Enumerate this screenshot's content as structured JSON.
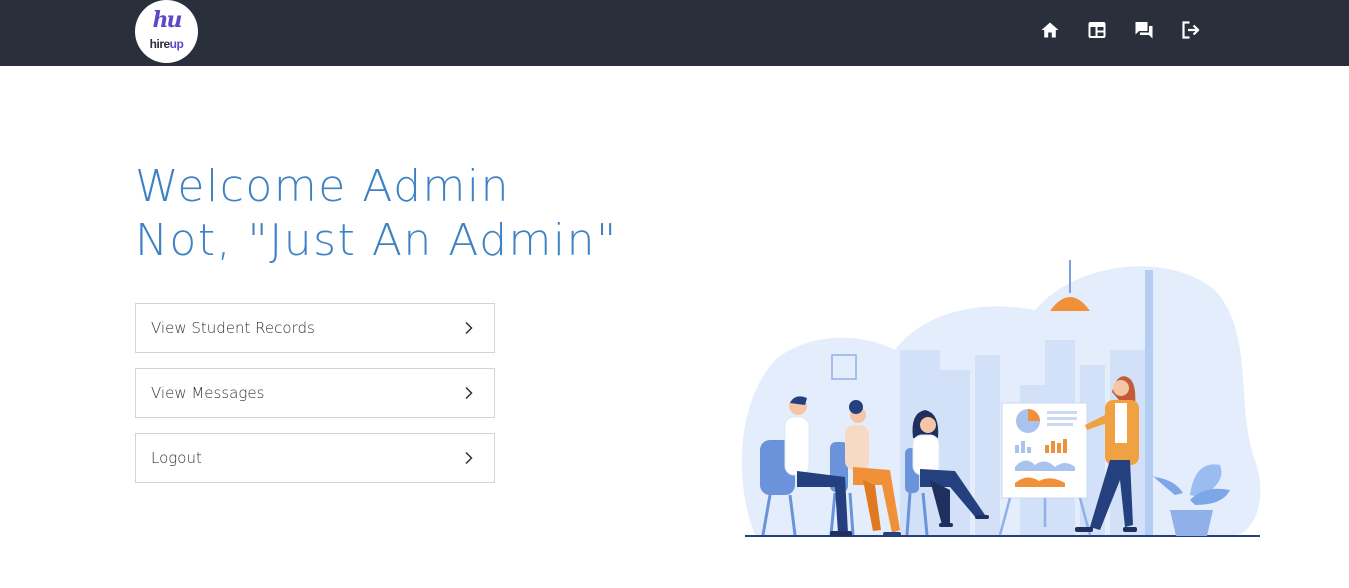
{
  "navbar": {
    "logo": {
      "mark": "hu",
      "word_part1": "hire",
      "word_part2": "up"
    },
    "icons": [
      {
        "name": "home-icon",
        "target": "home"
      },
      {
        "name": "dashboard-icon",
        "target": "dashboard"
      },
      {
        "name": "messages-icon",
        "target": "messages"
      },
      {
        "name": "logout-icon",
        "target": "logout"
      }
    ]
  },
  "hero": {
    "line1": "Welcome Admin",
    "line2": "Not, \"Just An Admin\""
  },
  "actions": [
    {
      "label": "View Student Records"
    },
    {
      "label": "View Messages"
    },
    {
      "label": "Logout"
    }
  ],
  "colors": {
    "navbar_bg": "#2a2f3c",
    "heading_blue": "#3e82c4",
    "logo_purple": "#5b49c9",
    "illustration_blob": "#e4edfc",
    "illustration_accent": "#f0913a",
    "illustration_navy": "#24407f"
  }
}
